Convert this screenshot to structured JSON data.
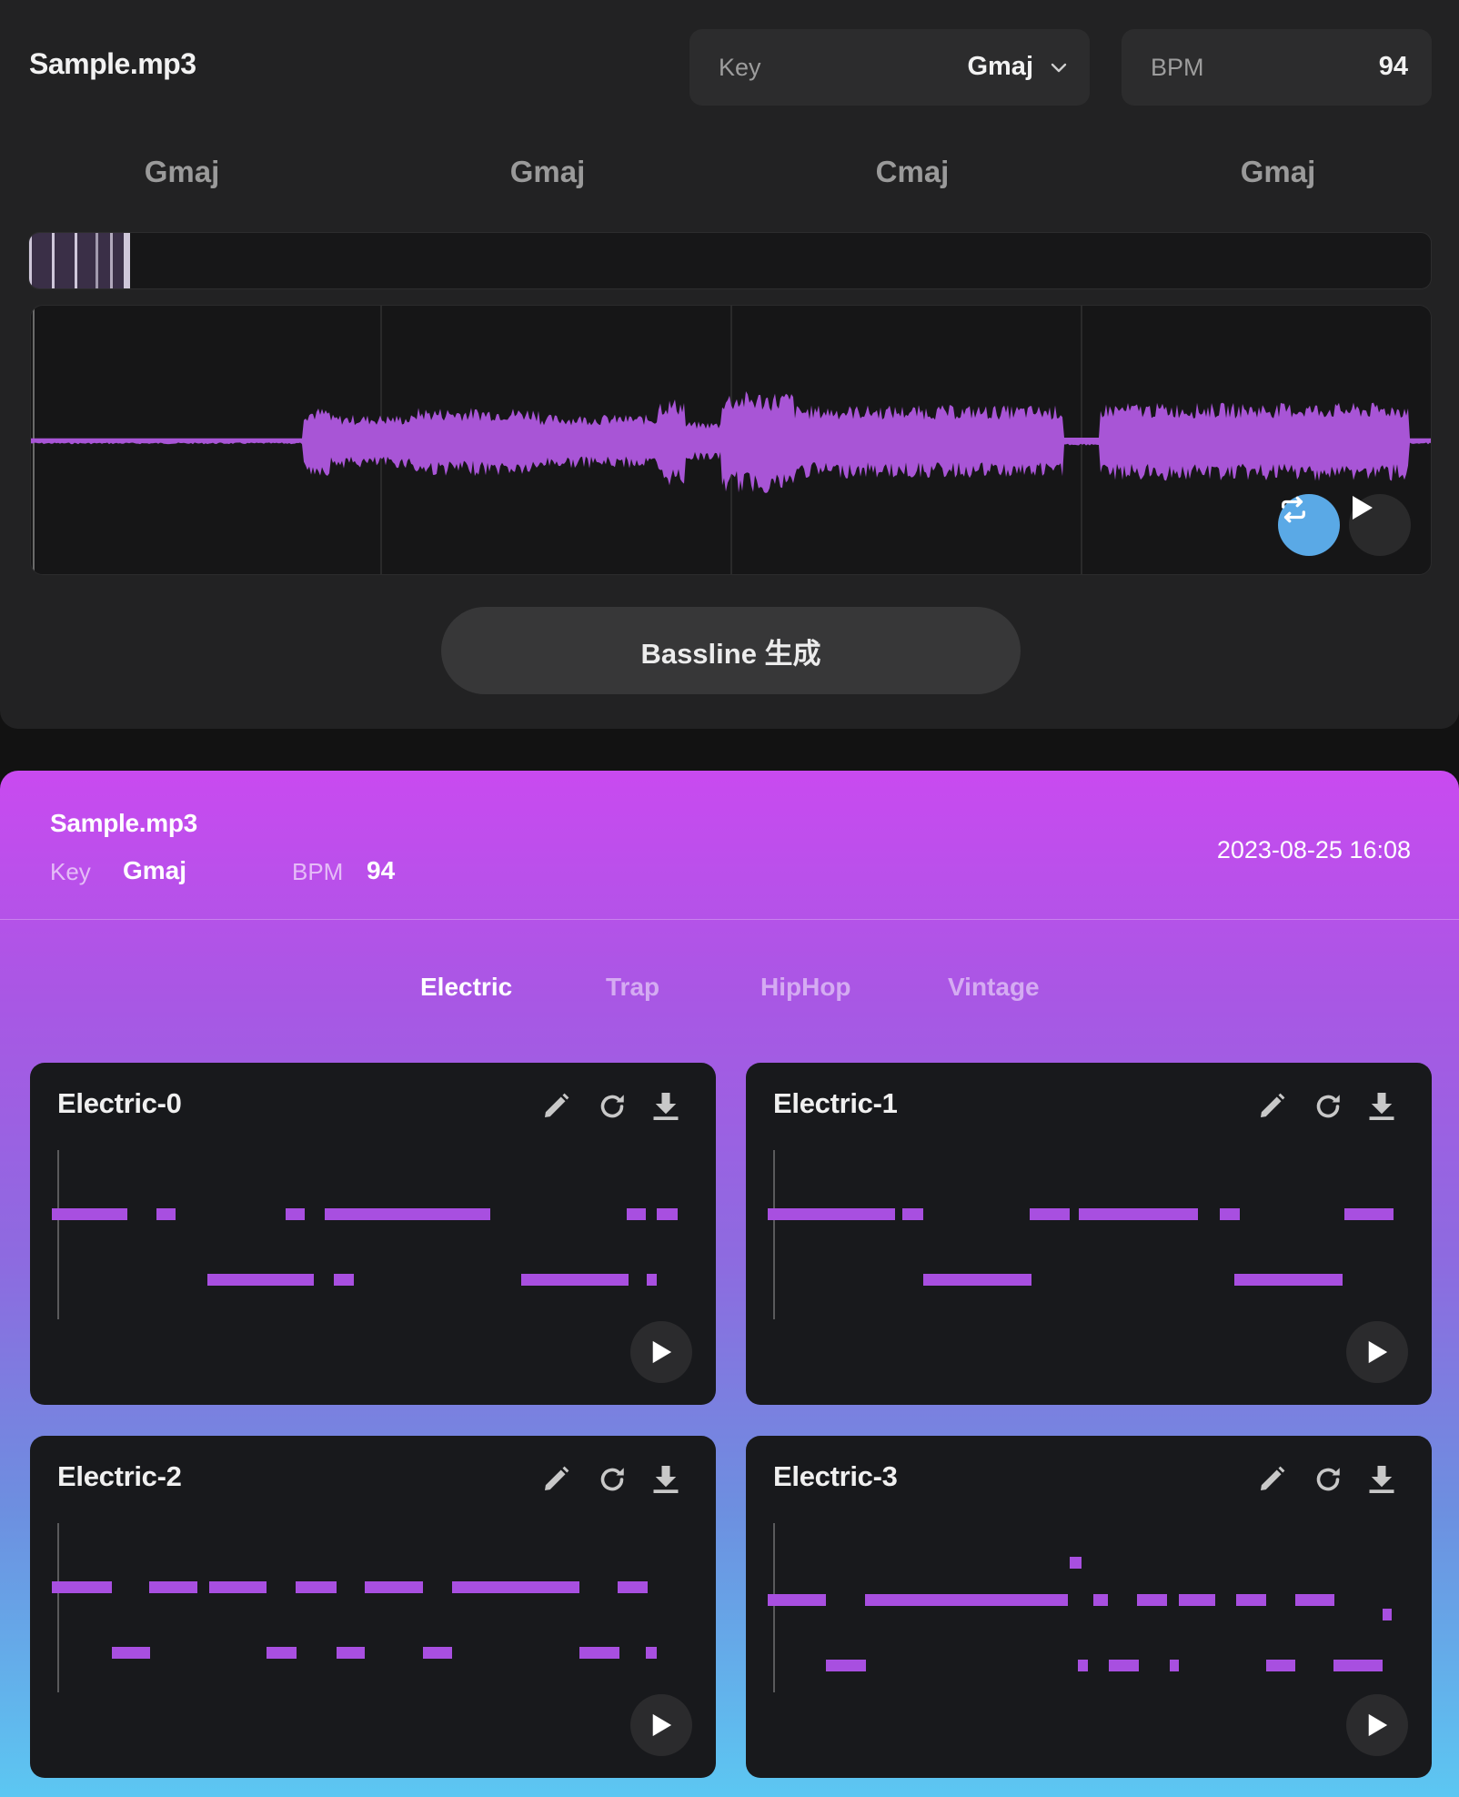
{
  "header": {
    "file_name": "Sample.mp3",
    "key_label": "Key",
    "key_value": "Gmaj",
    "bpm_label": "BPM",
    "bpm_value": "94"
  },
  "chords": [
    "Gmaj",
    "Gmaj",
    "Cmaj",
    "Gmaj"
  ],
  "player": {
    "loop_icon": "loop-icon",
    "play_icon": "play-icon",
    "waveform_color": "#a855d6"
  },
  "generate_button": "Bassline 生成",
  "result": {
    "file_name": "Sample.mp3",
    "key_label": "Key",
    "key_value": "Gmaj",
    "bpm_label": "BPM",
    "bpm_value": "94",
    "datetime": "2023-08-25 16:08"
  },
  "tabs": [
    {
      "label": "Electric",
      "active": true
    },
    {
      "label": "Trap",
      "active": false
    },
    {
      "label": "HipHop",
      "active": false
    },
    {
      "label": "Vintage",
      "active": false
    }
  ],
  "cards": [
    {
      "title": "Electric-0"
    },
    {
      "title": "Electric-1"
    },
    {
      "title": "Electric-2"
    },
    {
      "title": "Electric-3"
    }
  ],
  "colors": {
    "accent": "#b14ee8",
    "note": "#a84fe0",
    "loop_button": "#5aa9e6"
  }
}
